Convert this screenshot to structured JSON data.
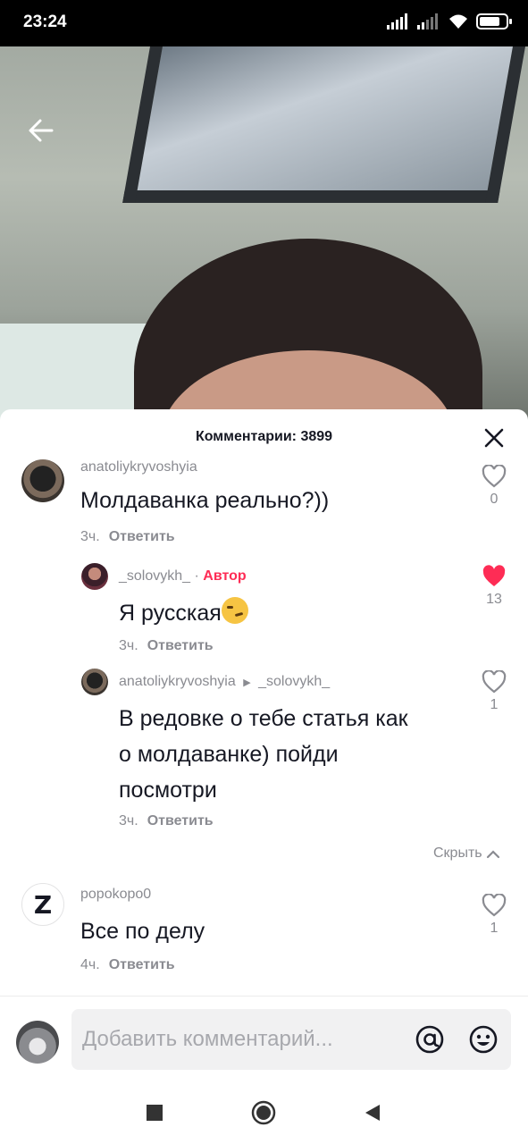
{
  "status_bar": {
    "time": "23:24"
  },
  "comments_panel": {
    "title": "Комментарии: 3899",
    "input_placeholder": "Добавить комментарий...",
    "hide_label": "Скрыть"
  },
  "comments": [
    {
      "username": "anatoliykryvoshyia",
      "text": "Молдаванка реально?))",
      "time": "3ч.",
      "reply_label": "Ответить",
      "likes": "0",
      "liked": false
    },
    {
      "username": "_solovykh_",
      "author_badge": "Автор",
      "text": "Я русская",
      "emoji": "smirking-face",
      "time": "3ч.",
      "reply_label": "Ответить",
      "likes": "13",
      "liked": true
    },
    {
      "username": "anatoliykryvoshyia",
      "reply_to": "_solovykh_",
      "text_lines": [
        "В редовке о тебе статья как",
        "о молдаванке) пойди",
        "посмотри"
      ],
      "time": "3ч.",
      "reply_label": "Ответить",
      "likes": "1",
      "liked": false
    },
    {
      "username": "popokopo0",
      "avatar_letter": "Z",
      "text": "Все по делу",
      "time": "4ч.",
      "reply_label": "Ответить",
      "likes": "1",
      "liked": false
    }
  ],
  "colors": {
    "author": "#fe2c55",
    "like_active": "#fe2c55",
    "muted_text": "#8a8b91"
  }
}
